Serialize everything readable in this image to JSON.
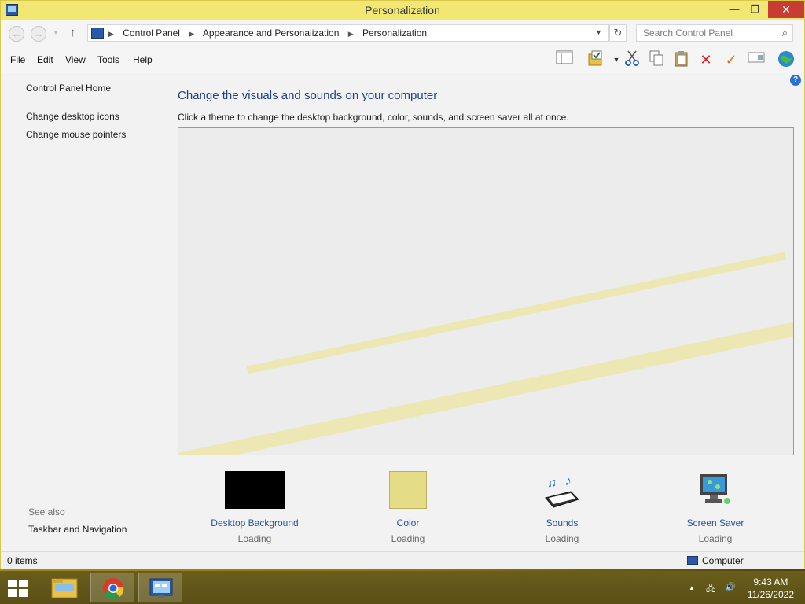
{
  "window": {
    "title": "Personalization"
  },
  "titlebar_buttons": {
    "minimize": "—",
    "restore": "❐",
    "close": "✕"
  },
  "address": {
    "crumbs": [
      "Control Panel",
      "Appearance and Personalization",
      "Personalization"
    ],
    "search_placeholder": "Search Control Panel"
  },
  "menu": {
    "file": "File",
    "edit": "Edit",
    "view": "View",
    "tools": "Tools",
    "help": "Help"
  },
  "sidebar": {
    "home": "Control Panel Home",
    "links": [
      "Change desktop icons",
      "Change mouse pointers"
    ],
    "see_also_title": "See also",
    "see_also_links": [
      "Taskbar and Navigation"
    ]
  },
  "main": {
    "heading": "Change the visuals and sounds on your computer",
    "subtext": "Click a theme to change the desktop background, color, sounds, and screen saver all at once."
  },
  "items": [
    {
      "label": "Desktop Background",
      "status": "Loading",
      "thumb_color": "#000000"
    },
    {
      "label": "Color",
      "status": "Loading",
      "thumb_color": "#e4dc86"
    },
    {
      "label": "Sounds",
      "status": "Loading",
      "icon": "sounds-icon"
    },
    {
      "label": "Screen Saver",
      "status": "Loading",
      "icon": "screen-saver-icon"
    }
  ],
  "statusbar": {
    "items": "0 items",
    "location": "Computer"
  },
  "taskbar": {
    "time": "9:43 AM",
    "date": "11/26/2022"
  },
  "colors": {
    "title_bar": "#f1e772",
    "close_button": "#c73d33",
    "link": "#1f53a8",
    "heading": "#1f3f8f"
  }
}
